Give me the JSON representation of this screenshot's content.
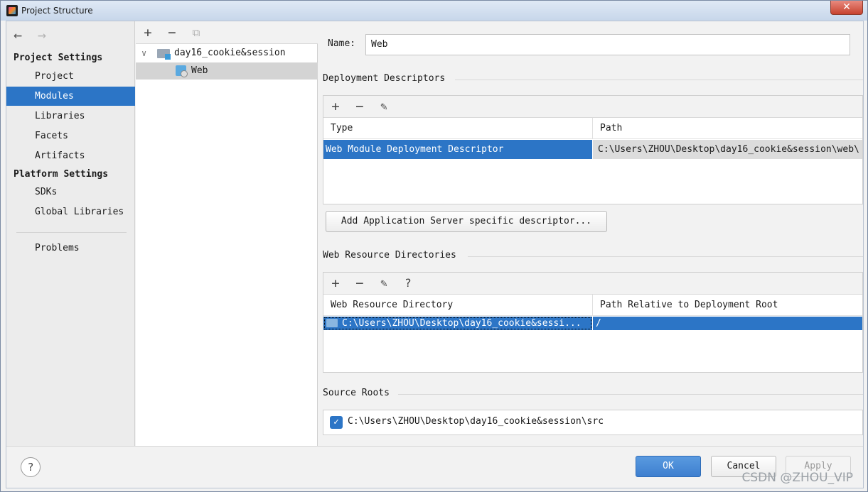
{
  "window": {
    "title": "Project Structure",
    "close_label": "✕"
  },
  "nav": {
    "back": "←",
    "forward": "→"
  },
  "sidebar": {
    "project_settings": "Project Settings",
    "platform_settings": "Platform Settings",
    "items": [
      "Project",
      "Modules",
      "Libraries",
      "Facets",
      "Artifacts"
    ],
    "platform_items": [
      "SDKs",
      "Global Libraries"
    ],
    "problems": "Problems",
    "active": "Modules"
  },
  "tree": {
    "toolbar": {
      "add": "+",
      "remove": "−",
      "copy": "⧉"
    },
    "module": "day16_cookie&session",
    "facet": "Web"
  },
  "facet": {
    "name_label": "Name:",
    "name_value": "Web",
    "deployment": {
      "title": "Deployment Descriptors",
      "toolbar": {
        "add": "+",
        "remove": "−",
        "edit": "✎"
      },
      "col_type": "Type",
      "col_path": "Path",
      "row_type": "Web Module Deployment Descriptor",
      "row_path": "C:\\Users\\ZHOU\\Desktop\\day16_cookie&session\\web\\",
      "add_button": "Add Application Server specific descriptor..."
    },
    "resources": {
      "title": "Web Resource Directories",
      "toolbar": {
        "add": "+",
        "remove": "−",
        "edit": "✎",
        "help": "?"
      },
      "col_dir": "Web Resource Directory",
      "col_rel": "Path Relative to Deployment Root",
      "row_dir": "C:\\Users\\ZHOU\\Desktop\\day16_cookie&sessi...",
      "row_rel": "/"
    },
    "source_roots": {
      "title": "Source Roots",
      "checked": true,
      "path": "C:\\Users\\ZHOU\\Desktop\\day16_cookie&session\\src"
    }
  },
  "buttons": {
    "help": "?",
    "ok": "OK",
    "cancel": "Cancel",
    "apply": "Apply"
  },
  "watermark": "CSDN @ZHOU_VIP",
  "colors": {
    "selection": "#2c75c6",
    "window_bg": "#f2f2f2"
  }
}
